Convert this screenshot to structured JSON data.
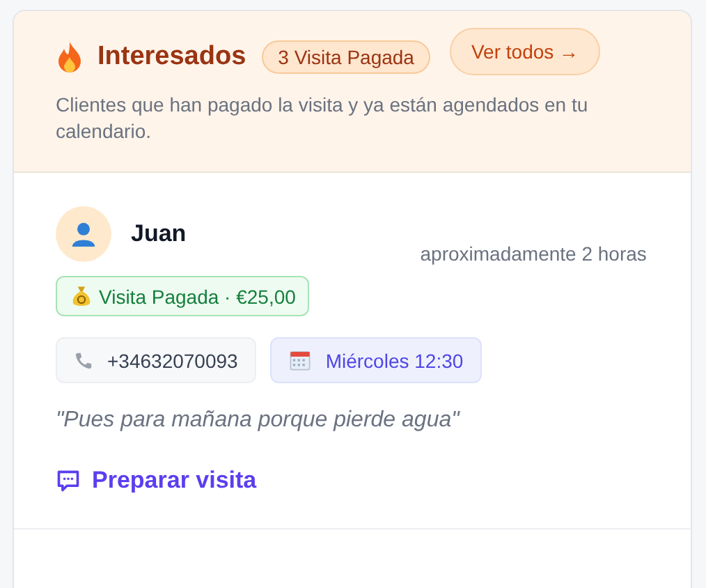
{
  "header": {
    "title": "Interesados",
    "count_badge": "3 Visita Pagada",
    "action": "Ver todos →",
    "description": "Clientes que han pagado la visita y ya están agendados en tu calendario."
  },
  "leads": [
    {
      "name": "Juan",
      "time": "aproximadamente 2 horas",
      "payment_badge": "Visita Pagada · €25,00",
      "phone": "+34632070093",
      "appointment": "Miércoles 12:30",
      "quote": "\"Pues para mañana porque pierde agua\"",
      "action": "Preparar visita"
    }
  ]
}
